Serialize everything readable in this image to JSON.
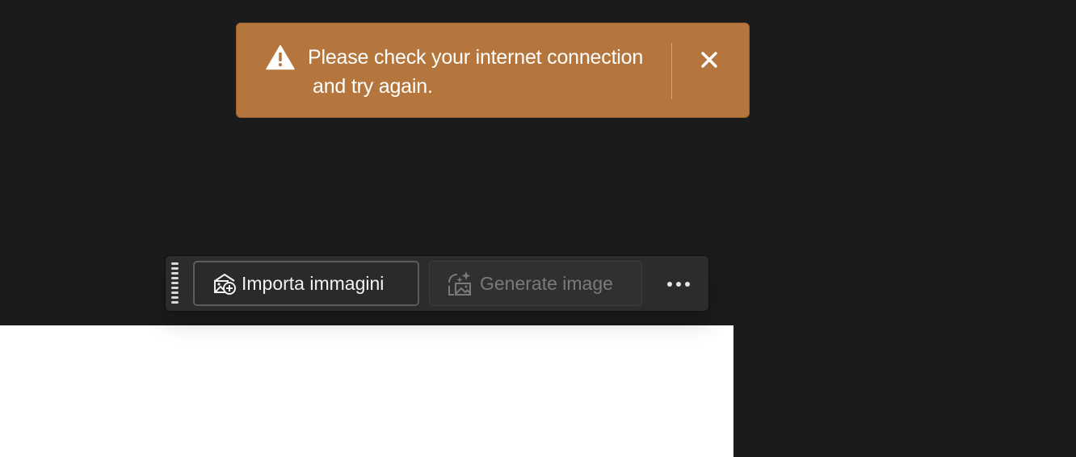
{
  "toast": {
    "message_line1": "Please check your internet connection",
    "message_line2": "and try again.",
    "icon": "warning-icon",
    "close_icon": "close-icon",
    "background_color": "#b5763d"
  },
  "toolbar": {
    "import_label": "Importa immagini",
    "import_icon": "import-images-icon",
    "generate_label": "Generate image",
    "generate_icon": "generate-image-icon",
    "more_icon": "more-options-icon"
  }
}
